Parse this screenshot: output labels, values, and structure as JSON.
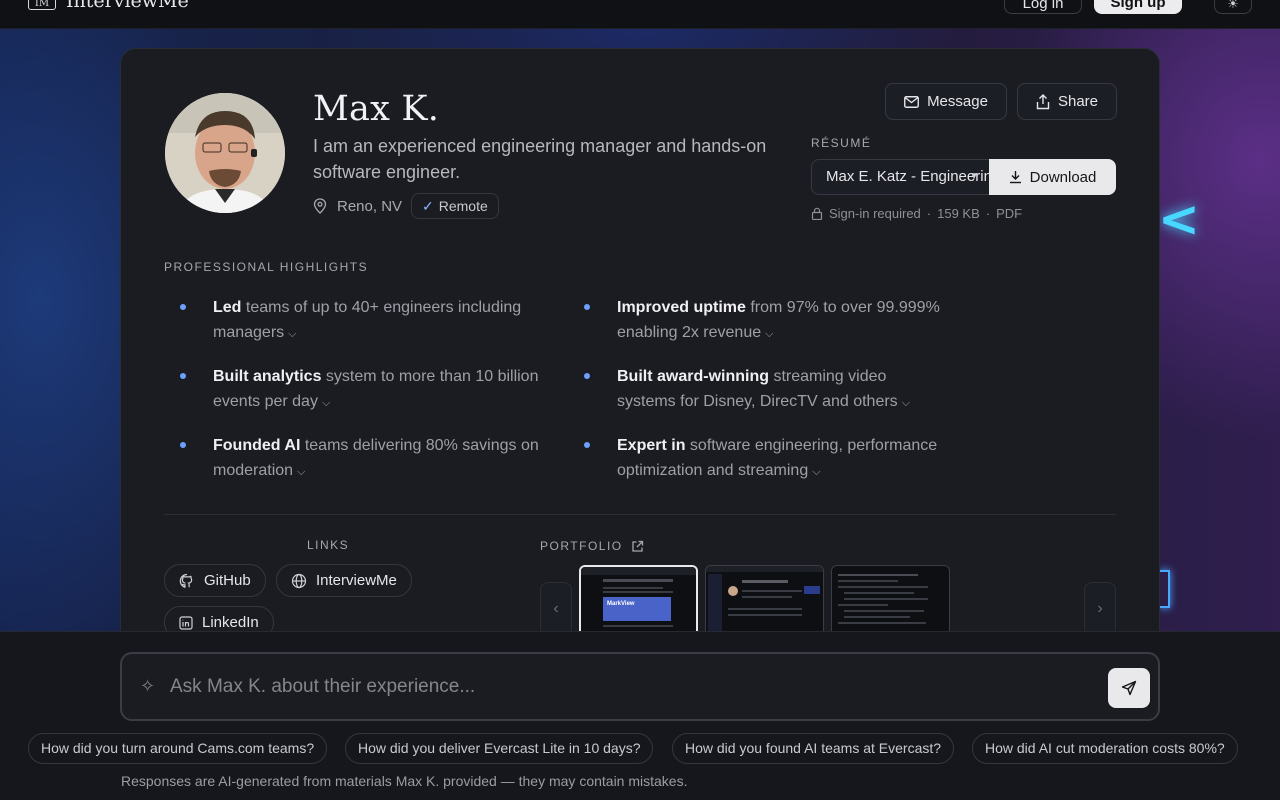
{
  "topbar": {
    "logo_mark": "IM",
    "logo_text": "InterviewMe",
    "login_label": "Log in",
    "signup_label": "Sign up"
  },
  "profile": {
    "name": "Max K.",
    "bio": "I am an experienced engineering manager and hands-on software engineer.",
    "location": "Reno, NV",
    "remote_label": "Remote",
    "message_label": "Message",
    "share_label": "Share"
  },
  "resume": {
    "label": "RÉSUMÉ",
    "selected": "Max E. Katz - Engineering Manager",
    "download_label": "Download",
    "signin_note": "Sign-in required",
    "size": "159 KB",
    "format": "PDF"
  },
  "highlights": {
    "title": "PROFESSIONAL HIGHLIGHTS",
    "items": [
      {
        "bold": "Led",
        "rest": " teams of up to 40+ engineers including managers"
      },
      {
        "bold": "Improved uptime",
        "rest": " from 97% to over 99.999% enabling 2x revenue"
      },
      {
        "bold": "Built analytics",
        "rest": " system to more than 10 billion events per day"
      },
      {
        "bold": "Built award-winning",
        "rest": " streaming video systems for Disney, DirecTV and others"
      },
      {
        "bold": "Founded AI",
        "rest": " teams delivering 80% savings on moderation"
      },
      {
        "bold": "Expert in",
        "rest": " software engineering, performance optimization and streaming"
      }
    ]
  },
  "links": {
    "title": "LINKS",
    "items": [
      {
        "label": "GitHub",
        "icon": "github-icon"
      },
      {
        "label": "InterviewMe",
        "icon": "globe-icon"
      },
      {
        "label": "LinkedIn",
        "icon": "linkedin-icon"
      }
    ]
  },
  "portfolio": {
    "title": "PORTFOLIO",
    "thumb1_text": "MarkView"
  },
  "ask": {
    "placeholder": "Ask Max K. about their experience...",
    "suggestions": [
      "How did you turn around Cams.com teams?",
      "How did you deliver Evercast Lite in 10 days?",
      "How did you found AI teams at Evercast?",
      "How did AI cut moderation costs 80%?"
    ],
    "disclaimer": "Responses are AI-generated from materials Max K. provided — they may contain mistakes."
  },
  "colors": {
    "accent_blue": "#6ea0ff",
    "card_bg": "#1a1c22",
    "neon": "#48d7ff"
  }
}
